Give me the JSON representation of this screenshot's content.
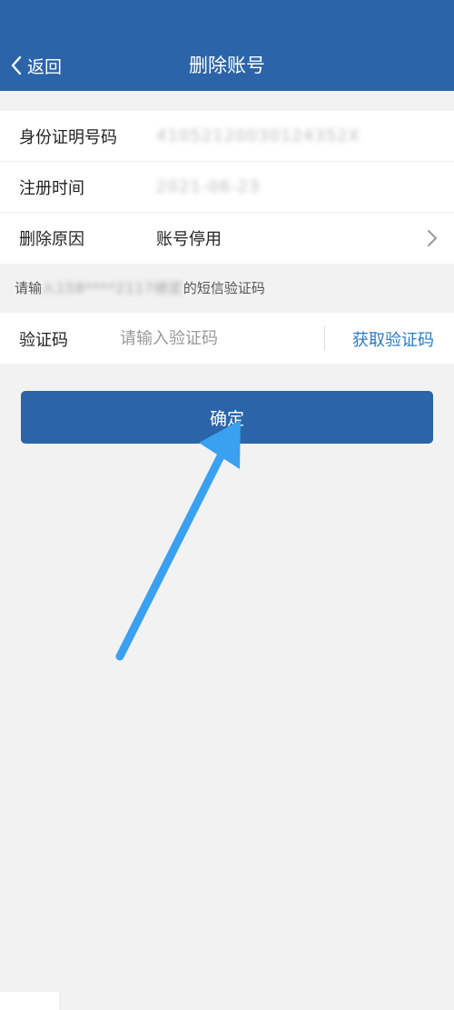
{
  "header": {
    "back_label": "返回",
    "title": "删除账号",
    "background": "#2b64a8"
  },
  "info": {
    "rows": [
      {
        "label": "身份证明号码",
        "value": "41052120030124352X",
        "masked": true
      },
      {
        "label": "注册时间",
        "value": "2021-06-23",
        "masked": true
      },
      {
        "label": "删除原因",
        "value": "账号停用",
        "masked": false,
        "has_chevron": true
      }
    ]
  },
  "sms": {
    "hint_prefix": "请输",
    "hint_masked": "入158****2117绑定",
    "hint_suffix": "的短信验证码"
  },
  "verification": {
    "label": "验证码",
    "placeholder": "请输入验证码",
    "get_code_label": "获取验证码"
  },
  "confirm_button": {
    "label": "确定"
  },
  "colors": {
    "primary": "#2b64a8",
    "link": "#2b7ac9",
    "annotation_arrow": "#3aa0f0"
  },
  "icons": {
    "back": "chevron-left-icon",
    "row_chevron": "chevron-right-icon",
    "annotation": "arrow-icon"
  }
}
